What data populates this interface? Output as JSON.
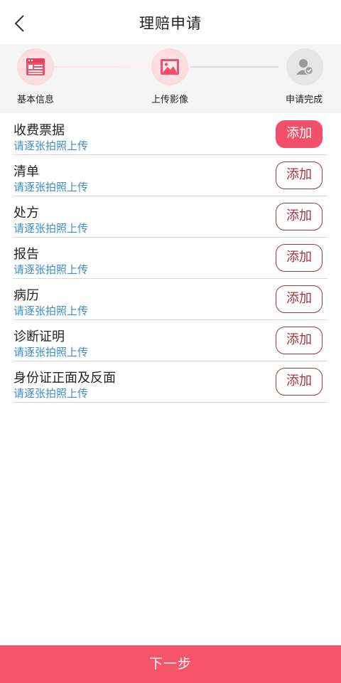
{
  "header": {
    "title": "理赔申请",
    "back_icon": "chevron-left-icon"
  },
  "steps": [
    {
      "label": "基本信息",
      "icon": "form-icon",
      "status": "active"
    },
    {
      "label": "上传影像",
      "icon": "image-icon",
      "status": "active"
    },
    {
      "label": "申请完成",
      "icon": "user-check-icon",
      "status": "inactive"
    }
  ],
  "items": [
    {
      "title": "收费票据",
      "hint": "请逐张拍照上传",
      "button": "添加"
    },
    {
      "title": "清单",
      "hint": "请逐张拍照上传",
      "button": "添加"
    },
    {
      "title": "处方",
      "hint": "请逐张拍照上传",
      "button": "添加"
    },
    {
      "title": "报告",
      "hint": "请逐张拍照上传",
      "button": "添加"
    },
    {
      "title": "病历",
      "hint": "请逐张拍照上传",
      "button": "添加"
    },
    {
      "title": "诊断证明",
      "hint": "请逐张拍照上传",
      "button": "添加"
    },
    {
      "title": "身份证正面及反面",
      "hint": "请逐张拍照上传",
      "button": "添加"
    }
  ],
  "footer": {
    "next_label": "下一步"
  },
  "colors": {
    "accent": "#f55469",
    "button_outline": "#a83440",
    "hint_text": "#3d8fc2",
    "step_bg": "#f5f5f5"
  }
}
